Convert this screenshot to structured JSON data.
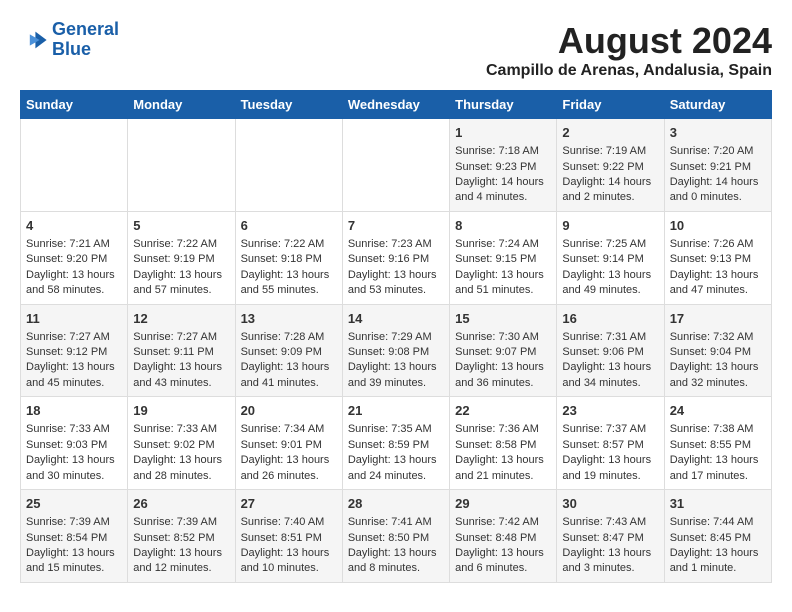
{
  "header": {
    "logo_line1": "General",
    "logo_line2": "Blue",
    "title": "August 2024",
    "subtitle": "Campillo de Arenas, Andalusia, Spain"
  },
  "days_of_week": [
    "Sunday",
    "Monday",
    "Tuesday",
    "Wednesday",
    "Thursday",
    "Friday",
    "Saturday"
  ],
  "weeks": [
    [
      {
        "day": "",
        "info": ""
      },
      {
        "day": "",
        "info": ""
      },
      {
        "day": "",
        "info": ""
      },
      {
        "day": "",
        "info": ""
      },
      {
        "day": "1",
        "info": "Sunrise: 7:18 AM\nSunset: 9:23 PM\nDaylight: 14 hours\nand 4 minutes."
      },
      {
        "day": "2",
        "info": "Sunrise: 7:19 AM\nSunset: 9:22 PM\nDaylight: 14 hours\nand 2 minutes."
      },
      {
        "day": "3",
        "info": "Sunrise: 7:20 AM\nSunset: 9:21 PM\nDaylight: 14 hours\nand 0 minutes."
      }
    ],
    [
      {
        "day": "4",
        "info": "Sunrise: 7:21 AM\nSunset: 9:20 PM\nDaylight: 13 hours\nand 58 minutes."
      },
      {
        "day": "5",
        "info": "Sunrise: 7:22 AM\nSunset: 9:19 PM\nDaylight: 13 hours\nand 57 minutes."
      },
      {
        "day": "6",
        "info": "Sunrise: 7:22 AM\nSunset: 9:18 PM\nDaylight: 13 hours\nand 55 minutes."
      },
      {
        "day": "7",
        "info": "Sunrise: 7:23 AM\nSunset: 9:16 PM\nDaylight: 13 hours\nand 53 minutes."
      },
      {
        "day": "8",
        "info": "Sunrise: 7:24 AM\nSunset: 9:15 PM\nDaylight: 13 hours\nand 51 minutes."
      },
      {
        "day": "9",
        "info": "Sunrise: 7:25 AM\nSunset: 9:14 PM\nDaylight: 13 hours\nand 49 minutes."
      },
      {
        "day": "10",
        "info": "Sunrise: 7:26 AM\nSunset: 9:13 PM\nDaylight: 13 hours\nand 47 minutes."
      }
    ],
    [
      {
        "day": "11",
        "info": "Sunrise: 7:27 AM\nSunset: 9:12 PM\nDaylight: 13 hours\nand 45 minutes."
      },
      {
        "day": "12",
        "info": "Sunrise: 7:27 AM\nSunset: 9:11 PM\nDaylight: 13 hours\nand 43 minutes."
      },
      {
        "day": "13",
        "info": "Sunrise: 7:28 AM\nSunset: 9:09 PM\nDaylight: 13 hours\nand 41 minutes."
      },
      {
        "day": "14",
        "info": "Sunrise: 7:29 AM\nSunset: 9:08 PM\nDaylight: 13 hours\nand 39 minutes."
      },
      {
        "day": "15",
        "info": "Sunrise: 7:30 AM\nSunset: 9:07 PM\nDaylight: 13 hours\nand 36 minutes."
      },
      {
        "day": "16",
        "info": "Sunrise: 7:31 AM\nSunset: 9:06 PM\nDaylight: 13 hours\nand 34 minutes."
      },
      {
        "day": "17",
        "info": "Sunrise: 7:32 AM\nSunset: 9:04 PM\nDaylight: 13 hours\nand 32 minutes."
      }
    ],
    [
      {
        "day": "18",
        "info": "Sunrise: 7:33 AM\nSunset: 9:03 PM\nDaylight: 13 hours\nand 30 minutes."
      },
      {
        "day": "19",
        "info": "Sunrise: 7:33 AM\nSunset: 9:02 PM\nDaylight: 13 hours\nand 28 minutes."
      },
      {
        "day": "20",
        "info": "Sunrise: 7:34 AM\nSunset: 9:01 PM\nDaylight: 13 hours\nand 26 minutes."
      },
      {
        "day": "21",
        "info": "Sunrise: 7:35 AM\nSunset: 8:59 PM\nDaylight: 13 hours\nand 24 minutes."
      },
      {
        "day": "22",
        "info": "Sunrise: 7:36 AM\nSunset: 8:58 PM\nDaylight: 13 hours\nand 21 minutes."
      },
      {
        "day": "23",
        "info": "Sunrise: 7:37 AM\nSunset: 8:57 PM\nDaylight: 13 hours\nand 19 minutes."
      },
      {
        "day": "24",
        "info": "Sunrise: 7:38 AM\nSunset: 8:55 PM\nDaylight: 13 hours\nand 17 minutes."
      }
    ],
    [
      {
        "day": "25",
        "info": "Sunrise: 7:39 AM\nSunset: 8:54 PM\nDaylight: 13 hours\nand 15 minutes."
      },
      {
        "day": "26",
        "info": "Sunrise: 7:39 AM\nSunset: 8:52 PM\nDaylight: 13 hours\nand 12 minutes."
      },
      {
        "day": "27",
        "info": "Sunrise: 7:40 AM\nSunset: 8:51 PM\nDaylight: 13 hours\nand 10 minutes."
      },
      {
        "day": "28",
        "info": "Sunrise: 7:41 AM\nSunset: 8:50 PM\nDaylight: 13 hours\nand 8 minutes."
      },
      {
        "day": "29",
        "info": "Sunrise: 7:42 AM\nSunset: 8:48 PM\nDaylight: 13 hours\nand 6 minutes."
      },
      {
        "day": "30",
        "info": "Sunrise: 7:43 AM\nSunset: 8:47 PM\nDaylight: 13 hours\nand 3 minutes."
      },
      {
        "day": "31",
        "info": "Sunrise: 7:44 AM\nSunset: 8:45 PM\nDaylight: 13 hours\nand 1 minute."
      }
    ]
  ]
}
